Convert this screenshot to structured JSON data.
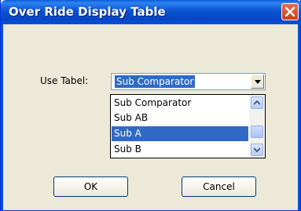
{
  "window": {
    "title": "Over Ride Display Table"
  },
  "form": {
    "label": "Use Tabel:",
    "selected_value": "Sub Comparator",
    "options": [
      "Sub Comparator",
      "Sub AB",
      "Sub A",
      "Sub B"
    ],
    "highlighted_option": "Sub A"
  },
  "buttons": {
    "ok": "OK",
    "cancel": "Cancel"
  },
  "icons": {
    "close": "close-icon",
    "dropdown": "chevron-down-icon",
    "scroll_up": "arrow-up-icon",
    "scroll_down": "arrow-down-icon"
  },
  "colors": {
    "titlebar": "#0a53d0",
    "selection": "#316ac5",
    "close": "#c6411d",
    "dialog_bg": "#ece9d8"
  }
}
